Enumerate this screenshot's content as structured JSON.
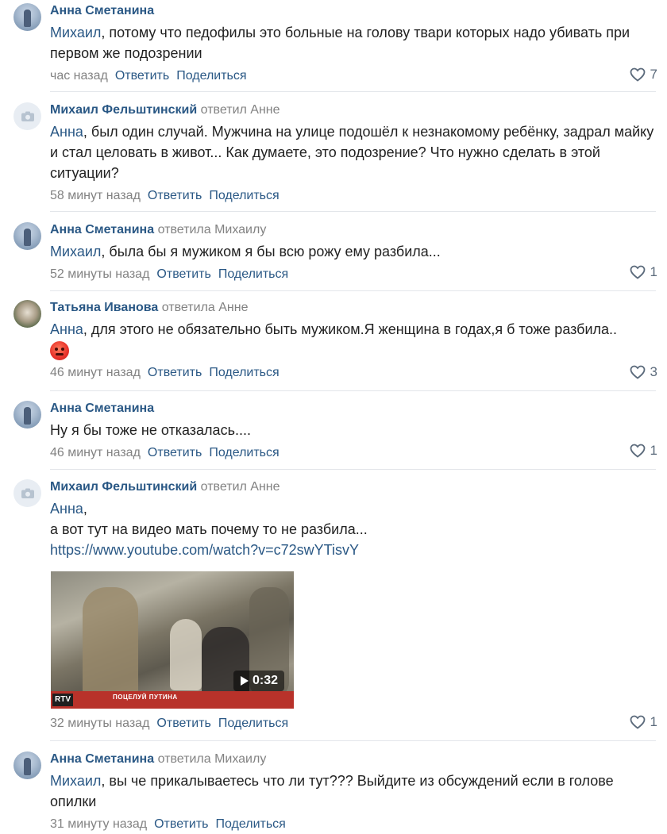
{
  "colors": {
    "author": "#2a5885",
    "muted": "#828282",
    "text": "#222222",
    "separator": "#e3e6ea"
  },
  "actions": {
    "reply": "Ответить",
    "share": "Поделиться"
  },
  "comments": [
    {
      "author": "Анна Сметанина",
      "replied_to": "",
      "mention": "Михаил",
      "text": ", потому что педофилы это больные на голову твари которых надо убивать при первом же подозрении",
      "time": "час назад",
      "likes": "7"
    },
    {
      "author": "Михаил Фельштинский",
      "replied_to": "ответил Анне",
      "mention": "Анна",
      "text": ", был один случай. Мужчина на улице подошёл к незнакомому ребёнку, задрал майку и стал целовать в живот... Как думаете, это подозрение? Что нужно сделать в этой ситуации?",
      "time": "58 минут назад",
      "likes": ""
    },
    {
      "author": "Анна Сметанина",
      "replied_to": "ответила Михаилу",
      "mention": "Михаил",
      "text": ", была бы я мужиком я бы всю рожу ему разбила...",
      "time": "52 минуты назад",
      "likes": "1"
    },
    {
      "author": "Татьяна Иванова",
      "replied_to": "ответила Анне",
      "mention": "Анна",
      "text": ", для этого не обязательно быть мужиком.Я женщина в годах,я б тоже разбила..",
      "time": "46 минут назад",
      "likes": "3"
    },
    {
      "author": "Анна Сметанина",
      "replied_to": "",
      "mention": "",
      "text": "Ну я бы тоже не отказалась....",
      "time": "46 минут назад",
      "likes": "1"
    },
    {
      "author": "Михаил Фельштинский",
      "replied_to": "ответил Анне",
      "mention": "Анна",
      "text": ",",
      "text2": "а вот тут на видео мать почему то не разбила...",
      "link": "https://www.youtube.com/watch?v=c72swYTisvY",
      "video_duration": "0:32",
      "video_logo": "RTV",
      "video_caption": "ПОЦЕЛУЙ ПУТИНА",
      "time": "32 минуты назад",
      "likes": "1"
    },
    {
      "author": "Анна Сметанина",
      "replied_to": "ответила Михаилу",
      "mention": "Михаил",
      "text": ", вы че прикалываетесь что ли тут??? Выйдите из обсуждений если в голове опилки",
      "time": "31 минуту назад",
      "likes": ""
    }
  ]
}
